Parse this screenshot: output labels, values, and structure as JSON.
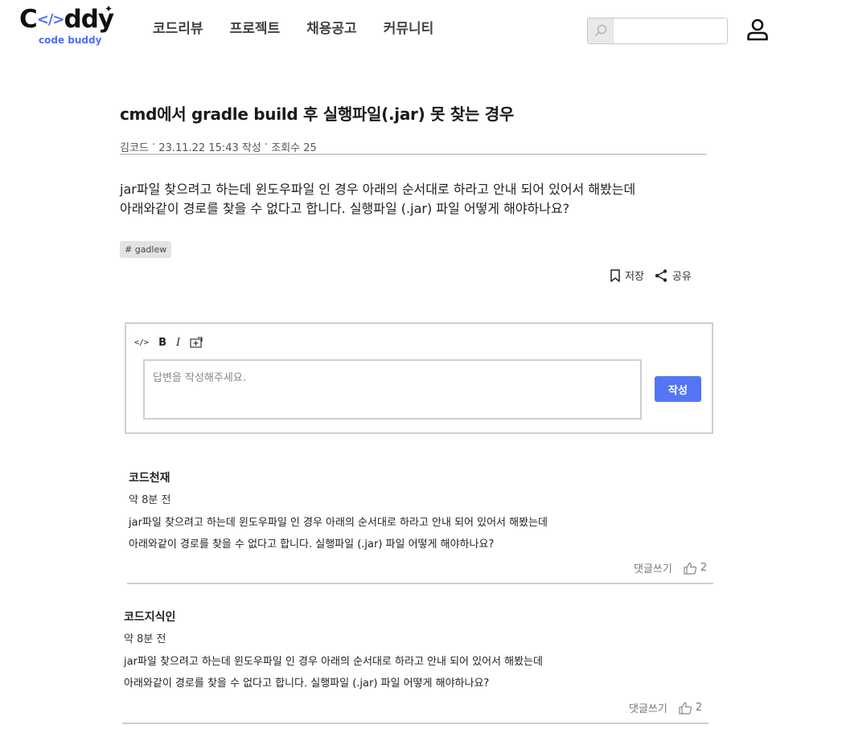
{
  "header": {
    "logo_text": "C</>ddy",
    "logo_sub": "code buddy",
    "nav": [
      "코드리뷰",
      "프로젝트",
      "채용공고",
      "커뮤니티"
    ],
    "search_placeholder": "",
    "search_value": ""
  },
  "post": {
    "title": "cmd에서 gradle build 후 실행파일(.jar) 못 찾는 경우",
    "author": "김코드",
    "date": "23.11.22 15:43 작성",
    "views": "조회수 25",
    "body": [
      "jar파일 찾으려고 하는데 윈도우파일 인 경우 아래의 순서대로 하라고 안내 되어 있어서 해봤는데",
      "아래와같이 경로를 찾을 수 없다고 합니다. 실행파일 (.jar) 파일 어떻게 해야하나요?"
    ],
    "tag": "# gadlew",
    "save_label": "저장",
    "share_label": "공유"
  },
  "editor": {
    "toolbar": {
      "code": "</>",
      "bold": "B",
      "italic": "I"
    },
    "placeholder": "답변을 작성해주세요.",
    "submit_label": "작성"
  },
  "comments": [
    {
      "author": "코드천재",
      "time": "약 8분 전",
      "text": [
        "jar파일 찾으려고 하는데 윈도우파일 인 경우 아래의 순서대로 하라고 안내 되어 있어서 해봤는데",
        "아래와같이 경로를 찾을 수 없다고 합니다. 실행파일 (.jar) 파일 어떻게 해야하나요?"
      ],
      "reply_label": "댓글쓰기",
      "likes": "2"
    },
    {
      "author": "코드지식인",
      "time": "약 8분 전",
      "text": [
        "jar파일 찾으려고 하는데 윈도우파일 인 경우 아래의 순서대로 하라고 안내 되어 있어서 해봤는데",
        "아래와같이 경로를 찾을 수 없다고 합니다. 실행파일 (.jar) 파일 어떻게 해야하나요?"
      ],
      "reply_label": "댓글쓰기",
      "likes": "2"
    }
  ],
  "colors": {
    "accent": "#5576f4",
    "logo_blue": "#4f6ff0",
    "divider": "#cfcfcf"
  },
  "icons": [
    "search-icon",
    "user-icon",
    "bookmark-icon",
    "share-icon",
    "image-add-icon",
    "thumbs-up-icon"
  ]
}
